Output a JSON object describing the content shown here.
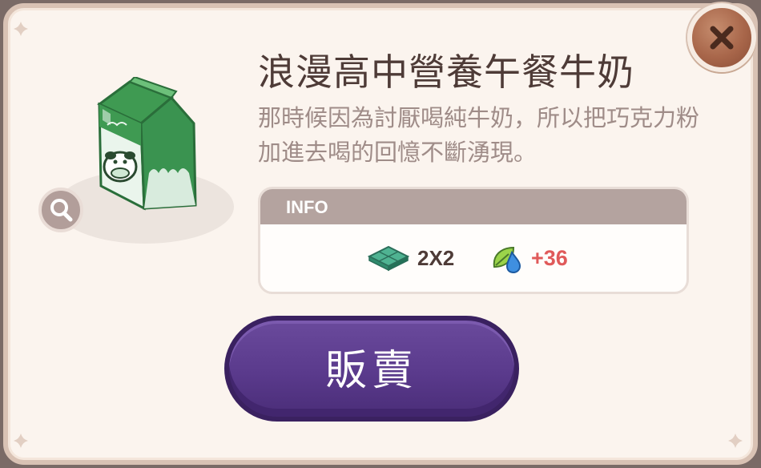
{
  "item": {
    "title": "浪漫高中營養午餐牛奶",
    "description": "那時候因為討厭喝純牛奶，所以把巧克力粉加進去喝的回憶不斷湧現。"
  },
  "info": {
    "header": "INFO",
    "size_value": "2X2",
    "bonus_value": "+36"
  },
  "actions": {
    "sell_label": "販賣"
  },
  "icons": {
    "close": "close-icon",
    "zoom": "magnifier-icon",
    "size": "tile-size-icon",
    "bonus": "leaf-drop-icon"
  },
  "colors": {
    "panel_bg": "#fbf4ee",
    "panel_border": "#d9c2b4",
    "title_text": "#4e3b37",
    "desc_text": "#9f8c88",
    "info_header": "#b4a39f",
    "bonus_text": "#e05a5a",
    "sell_button": "#5a3a8c",
    "close_button": "#a8664a"
  }
}
